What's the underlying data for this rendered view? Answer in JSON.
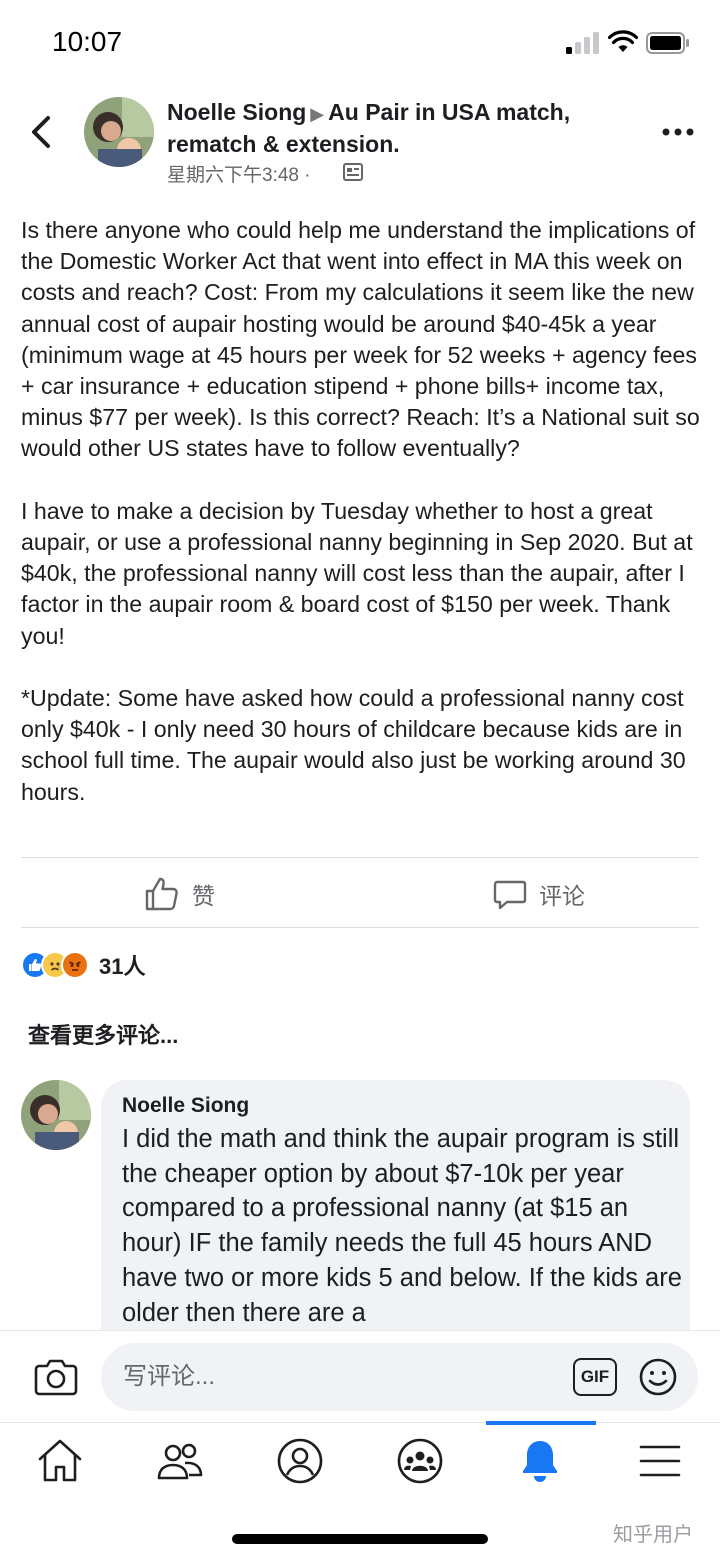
{
  "status_bar": {
    "time": "10:07"
  },
  "header": {
    "author": "Noelle Siong",
    "arrow": "▶",
    "group": "Au Pair in USA match, rematch & extension.",
    "timestamp": "星期六下午3:48 ·",
    "back_icon": "chevron-left-icon",
    "more_icon": "more-horizontal-icon",
    "audience_icon": "group-icon"
  },
  "post": {
    "paragraphs": [
      "Is there anyone who could help me understand the implications of the Domestic Worker Act that went into effect in MA this week on costs and reach? Cost: From my calculations it seem like the new annual cost of aupair hosting would be around $40-45k a year (minimum wage at 45 hours per week for 52 weeks + agency fees + car insurance + education stipend + phone bills+ income tax, minus $77 per week). Is this correct? Reach: It’s a National suit so would other US states have to follow eventually?",
      "I have to make a decision by Tuesday whether to host a great aupair, or use a professional nanny beginning in Sep 2020. But at $40k, the professional nanny will cost less than the aupair, after I factor in the aupair room & board cost of $150 per week.  Thank you!",
      "*Update: Some have asked how could a professional nanny cost only $40k - I only need 30 hours of childcare because kids are in school full time. The aupair would also just be working around 30 hours."
    ]
  },
  "actions": {
    "like_label": "赞",
    "comment_label": "评论"
  },
  "reactions": {
    "count": "31人",
    "icons": [
      "like-reaction-icon",
      "sad-reaction-icon",
      "angry-reaction-icon"
    ]
  },
  "comments": {
    "view_more": "查看更多评论...",
    "items": [
      {
        "author": "Noelle Siong",
        "text": "I did the math and think the aupair program is still the cheaper option by about $7-10k per year compared to a professional nanny (at $15 an hour) IF the family needs the full 45 hours AND have two or more kids 5 and below. If the kids are older then there are a"
      }
    ]
  },
  "compose": {
    "placeholder": "写评论...",
    "gif_label": "GIF"
  },
  "tab_bar": {
    "tabs": [
      "home-icon",
      "friends-icon",
      "profile-icon",
      "groups-icon",
      "notifications-icon",
      "menu-icon"
    ],
    "active": "notifications-icon",
    "accent": "#1877f2"
  },
  "watermark": "知乎用户"
}
